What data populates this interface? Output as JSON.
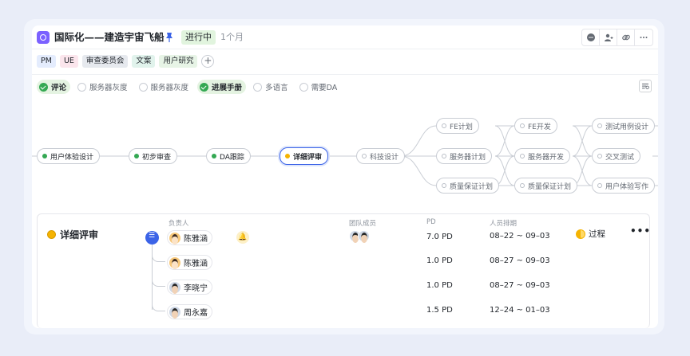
{
  "header": {
    "title": "国际化——建造宇宙飞船",
    "status": "进行中",
    "duration": "1个月",
    "tools": [
      "chat-icon",
      "people-icon",
      "link-icon",
      "more-icon"
    ]
  },
  "tags": [
    "PM",
    "UE",
    "审查委员会",
    "文案",
    "用户研究"
  ],
  "filters": [
    {
      "label": "评论",
      "checked": true
    },
    {
      "label": "服务器灰度",
      "checked": false
    },
    {
      "label": "服务器灰度",
      "checked": false
    },
    {
      "label": "进展手册",
      "checked": true
    },
    {
      "label": "多语言",
      "checked": false
    },
    {
      "label": "需要DA",
      "checked": false
    }
  ],
  "flow": {
    "n1": "用户体验设计",
    "n2": "初步审查",
    "n3": "DA跟踪",
    "n4": "详细评审",
    "n5": "科技设计",
    "n6": "FE计划",
    "n7": "服务器计划",
    "n8": "质量保证计划",
    "n9": "FE开发",
    "n10": "服务器开发",
    "n11": "质量保证计划",
    "n12": "测试用例设计",
    "n13": "交叉测试",
    "n14": "用户体验写作"
  },
  "detail": {
    "title": "详细评审",
    "col_owner": "负责人",
    "col_team": "团队成员",
    "col_pd": "PD",
    "col_schedule": "人员排期",
    "phase": "过程",
    "more": "•••",
    "rows": [
      {
        "name": "陈雅涵",
        "pd": "7.0 PD",
        "schedule": "08–22 ~ 09–03"
      },
      {
        "name": "陈雅涵",
        "pd": "1.0 PD",
        "schedule": "08–27 ~ 09–03"
      },
      {
        "name": "李晓宁",
        "pd": "1.0 PD",
        "schedule": "08–27 ~ 09–03"
      },
      {
        "name": "周永嘉",
        "pd": "1.5 PD",
        "schedule": "12–24 ~ 01–03"
      }
    ]
  },
  "colors": {
    "accent": "#3b63e7",
    "brand": "#7b61ff",
    "done": "#34a853",
    "in_progress": "#f5b301"
  }
}
